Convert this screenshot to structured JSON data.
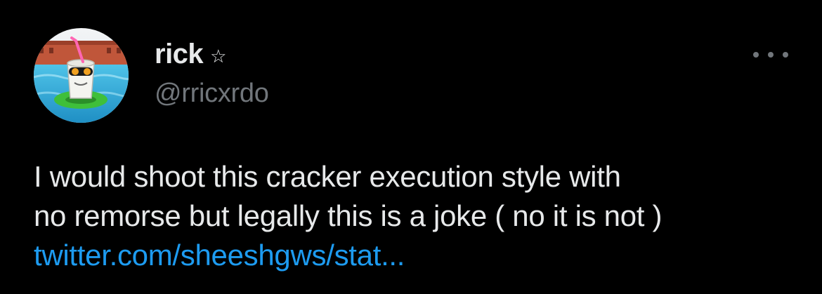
{
  "author": {
    "display_name": "rick",
    "badge_icon": "star-outline-icon",
    "handle": "@rricxrdo",
    "avatar_icon": "avatar-cartoon-cup-pool"
  },
  "menu": {
    "icon": "more-horizontal-icon"
  },
  "tweet": {
    "line1": "I would shoot this cracker execution style with",
    "line2": "no remorse but legally this is a joke ( no it is not )",
    "link": "twitter.com/sheeshgws/stat..."
  },
  "colors": {
    "background": "#000000",
    "text": "#e7e9ea",
    "secondary": "#71767b",
    "link": "#1d9bf0"
  }
}
